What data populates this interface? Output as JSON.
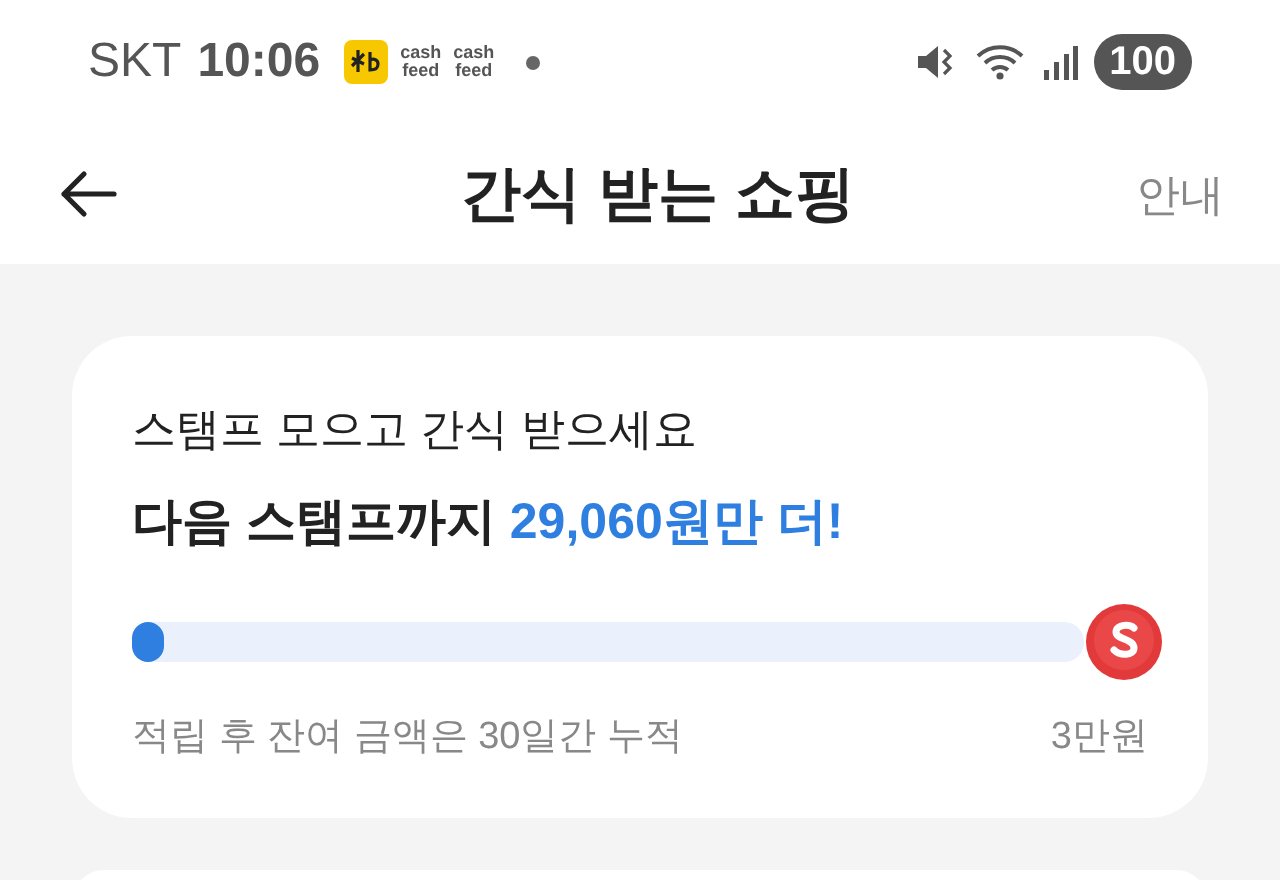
{
  "status_bar": {
    "carrier": "SKT",
    "time": "10:06",
    "app_icons": [
      {
        "kind": "kb"
      },
      {
        "kind": "text",
        "label": "cash\nfeed"
      },
      {
        "kind": "text",
        "label": "cash\nfeed"
      }
    ],
    "battery": "100"
  },
  "header": {
    "title": "간식 받는 쇼핑",
    "action": "안내"
  },
  "stamp_card": {
    "subtitle": "스탬프 모으고 간식 받으세요",
    "headline_prefix": "다음 스탬프까지",
    "headline_amount": "29,060원만 더!",
    "progress": {
      "level": 0.03
    },
    "note": "적립 후 잔여 금액은 30일간 누적",
    "goal": "3만원"
  }
}
